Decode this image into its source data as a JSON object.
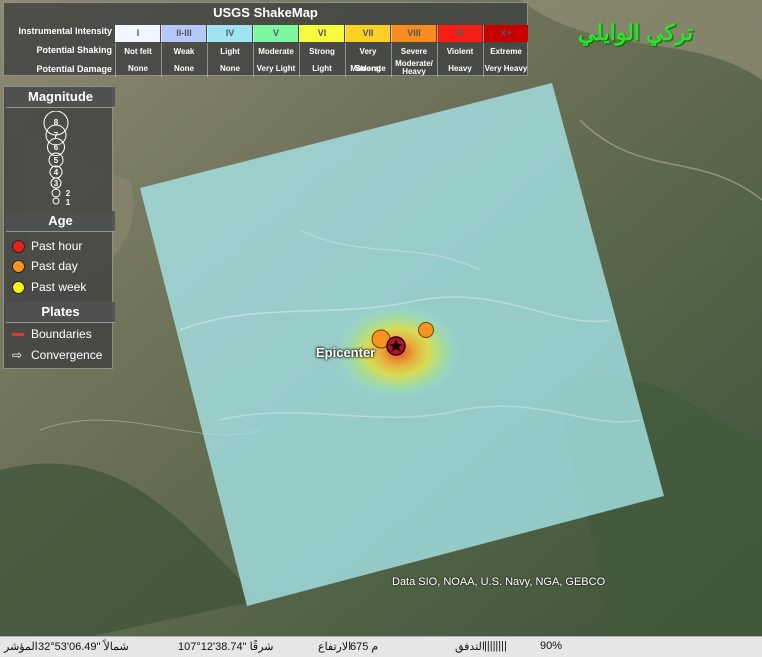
{
  "shakemap": {
    "title": "USGS ShakeMap",
    "row_labels": [
      "Instrumental Intensity",
      "Potential Shaking",
      "Potential Damage"
    ],
    "intensity": [
      "I",
      "II-III",
      "IV",
      "V",
      "VI",
      "VII",
      "VIII",
      "IX",
      "X+"
    ],
    "intensity_colors": [
      "#f2f6ff",
      "#b5c8f6",
      "#a0e4f4",
      "#7ff6a0",
      "#f8f83c",
      "#fbd027",
      "#f98c1e",
      "#f51e14",
      "#c80000"
    ],
    "shaking": [
      "Not felt",
      "Weak",
      "Light",
      "Moderate",
      "Strong",
      "Very Strong",
      "Severe",
      "Violent",
      "Extreme"
    ],
    "damage": [
      "None",
      "None",
      "None",
      "Very Light",
      "Light",
      "Moderate",
      "Moderate/ Heavy",
      "Heavy",
      "Very Heavy"
    ]
  },
  "legend": {
    "magnitude_title": "Magnitude",
    "magnitudes": [
      "8",
      "7",
      "6",
      "5",
      "4",
      "3",
      "2",
      "1"
    ],
    "age_title": "Age",
    "age_items": [
      {
        "label": "Past hour",
        "color": "#e8201a"
      },
      {
        "label": "Past day",
        "color": "#f7941d"
      },
      {
        "label": "Past week",
        "color": "#f5f21c"
      }
    ],
    "plates_title": "Plates",
    "plates_items": [
      "Boundaries",
      "Convergence"
    ],
    "boundary_color": "#e23a2a"
  },
  "map": {
    "epicenter_label": "Epicenter",
    "attribution": "Data SIO, NOAA, U.S. Navy, NGA, GEBCO",
    "watermark": "تركي الوايلي"
  },
  "status": {
    "pointer_label": "المؤشر",
    "lat": "32°53'06.49\" شمالاً",
    "lon": "107°12'38.74\" شرقًا",
    "elev_label": "الارتفاع",
    "elev": "675 م",
    "stream_label": "التدفق",
    "stream_bars": "||||||||",
    "stream_pct": "90%"
  }
}
